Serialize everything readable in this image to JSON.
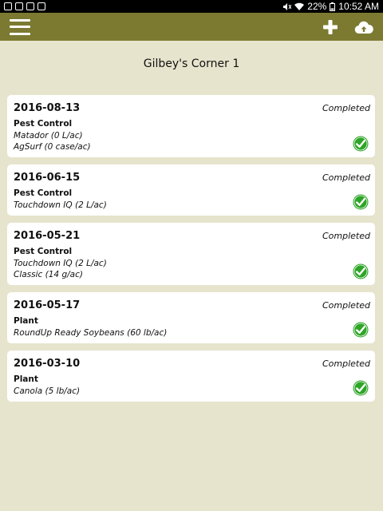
{
  "status_bar": {
    "battery": "22%",
    "time": "10:52 AM"
  },
  "toolbar": {
    "menu_icon": "hamburger-menu-icon",
    "add_icon": "plus-icon",
    "sync_icon": "cloud-upload-icon",
    "background": "#7c7a31"
  },
  "page": {
    "title": "Gilbey's Corner 1"
  },
  "colors": {
    "background": "#e7e4cd",
    "check": "#2ea527"
  },
  "records": [
    {
      "date": "2016-08-13",
      "status": "Completed",
      "type": "Pest Control",
      "products": [
        "Matador (0 L/ac)",
        "AgSurf (0 case/ac)"
      ]
    },
    {
      "date": "2016-06-15",
      "status": "Completed",
      "type": "Pest Control",
      "products": [
        "Touchdown IQ (2 L/ac)"
      ]
    },
    {
      "date": "2016-05-21",
      "status": "Completed",
      "type": "Pest Control",
      "products": [
        "Touchdown IQ (2 L/ac)",
        "Classic (14 g/ac)"
      ]
    },
    {
      "date": "2016-05-17",
      "status": "Completed",
      "type": "Plant",
      "products": [
        "RoundUp Ready Soybeans (60 lb/ac)"
      ]
    },
    {
      "date": "2016-03-10",
      "status": "Completed",
      "type": "Plant",
      "products": [
        "Canola (5 lb/ac)"
      ]
    }
  ]
}
